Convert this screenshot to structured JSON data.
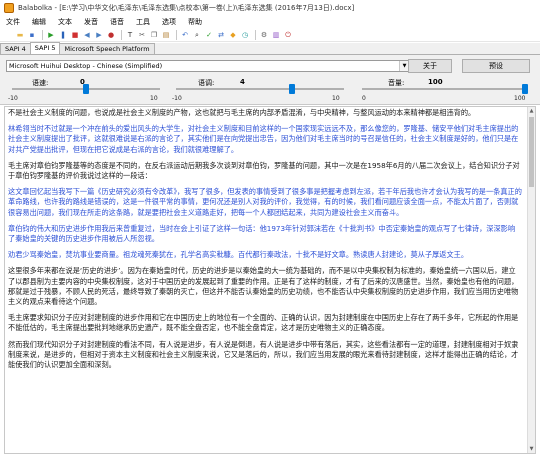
{
  "window": {
    "title": "Balabolka - [E:\\学习\\中华文化\\毛泽东\\毛泽东选集\\点校本\\第一卷(上)\\毛泽东选集 (2016年7月13日).docx]"
  },
  "menu": {
    "items": [
      "文件",
      "编辑",
      "文本",
      "发音",
      "语音",
      "工具",
      "选项",
      "帮助"
    ]
  },
  "toolbar": {
    "buttons": [
      {
        "icon": "new-document-icon",
        "glyph": "▫",
        "color": "#ffffff"
      },
      {
        "icon": "open-folder-icon",
        "glyph": "▬",
        "color": "#e8b84a"
      },
      {
        "icon": "save-icon",
        "glyph": "▪",
        "color": "#3b6ec9"
      },
      {
        "icon": "play-icon",
        "glyph": "▶",
        "color": "#2a9d2a"
      },
      {
        "icon": "pause-icon",
        "glyph": "❚",
        "color": "#2a62b8"
      },
      {
        "icon": "stop-icon",
        "glyph": "■",
        "color": "#d03030"
      },
      {
        "icon": "previous-icon",
        "glyph": "◀",
        "color": "#4a7fc2"
      },
      {
        "icon": "next-icon",
        "glyph": "▶",
        "color": "#4a7fc2"
      },
      {
        "icon": "record-icon",
        "glyph": "●",
        "color": "#c03030"
      },
      {
        "icon": "text-icon",
        "glyph": "T",
        "color": "#333333"
      },
      {
        "icon": "cut-icon",
        "glyph": "✂",
        "color": "#555555"
      },
      {
        "icon": "copy-icon",
        "glyph": "❐",
        "color": "#555555"
      },
      {
        "icon": "paste-icon",
        "glyph": "▤",
        "color": "#b07a2a"
      },
      {
        "icon": "undo-icon",
        "glyph": "↶",
        "color": "#3b6ec9"
      },
      {
        "icon": "find-icon",
        "glyph": "⌕",
        "color": "#333333"
      },
      {
        "icon": "spellcheck-icon",
        "glyph": "✓",
        "color": "#2a9d2a"
      },
      {
        "icon": "replace-icon",
        "glyph": "⇄",
        "color": "#3b6ec9"
      },
      {
        "icon": "bookmark-icon",
        "glyph": "◆",
        "color": "#e8a020"
      },
      {
        "icon": "clock-icon",
        "glyph": "◷",
        "color": "#2a9d9d"
      },
      {
        "icon": "settings-icon",
        "glyph": "⚙",
        "color": "#606060"
      },
      {
        "icon": "dictionary-icon",
        "glyph": "▥",
        "color": "#8a4bc2"
      },
      {
        "icon": "exit-icon",
        "glyph": "⏻",
        "color": "#c03030"
      }
    ]
  },
  "tabs": [
    {
      "label": "SAPI 4",
      "active": false
    },
    {
      "label": "SAPI 5",
      "active": true
    },
    {
      "label": "Microsoft Speech Platform",
      "active": false
    }
  ],
  "voice": {
    "selected": "Microsoft Huihui Desktop - Chinese (Simplified)",
    "apply_label": "关于",
    "preset_label": "预设"
  },
  "sliders": {
    "rate": {
      "label": "语速:",
      "value": "0",
      "min_label": "-10",
      "max_label": "10",
      "position": 0.5
    },
    "pitch": {
      "label": "语调:",
      "value": "4",
      "min_label": "-10",
      "max_label": "10",
      "position": 0.7
    },
    "volume": {
      "label": "音量:",
      "value": "100",
      "min_label": "0",
      "max_label": "100",
      "position": 1.0
    }
  },
  "editor": {
    "paragraphs": [
      {
        "blue": false,
        "text": "不是社会主义制度的问题，也说成是社会主义制度的产物，这也就把与毛主席的内部矛盾混淆，与中央精神，与整风运动的本来精神都是相违背的。"
      },
      {
        "blue": true,
        "text": "林希翎当时不过就是一个冲在前头的爱出风头的大学生，对社会主义制度和目前这样的一个国家现实远远不及，那么像您的，罗隆基、储安平他们对毛主席提出的社会主义制度提出了批评，这就很难说是右派的言论了，其实他们是在向党提出忠告，因为他们对毛主席当时的号召是信任的，社会主义制度是好的，他们只是在对共产党提出批评，但现在把它说成是右派的言论，我们就很难理解了。"
      },
      {
        "blue": false,
        "text": "毛主席对章伯钧罗隆基等的态度是不同的，在反右派运动后期我多次谈到对章伯钧，罗隆基的问题，其中一次是在1958年6月的八届二次会议上，结合知识分子对于章伯钧罗隆基的评价我说过这样的一段话："
      },
      {
        "blue": true,
        "text": "这文章回忆起当我写下一篇《历史研究必须有令改革》，我写了很多，但发表的事情受到了很多事是把握考虑到左派，若干年后我也许才会认为我写的是一条真正的革命路线，也许我的路线是错误的，这是一件很平常的事情，更何况还是别人对我的评价，我觉得，有的时候，我们看问题应该全面一点，不能太片面了，否则就很容易出问题，我们现在所走的这条路，就是要把社会主义道路走好，把每一个人都团结起来，共同为建设社会主义而奋斗。"
      },
      {
        "blue": true,
        "text": "章伯钧的伟大和历史进步作用我后来曾重复过，当时在会上引证了这样一句话：他1973年针对郭沫若在《十批判书》中否定秦始皇的观点写了七律诗，深深影响了秦始皇的关键的历史进步作用被后人所忽视。"
      },
      {
        "blue": true,
        "text": "劝君少骂秦始皇，焚坑事业要商量。祖龙魂死秦犹在，孔学名高实秕糠。百代都行秦政法，十批不是好文章。熟读唐人封建论，莫从子厚返文王。"
      },
      {
        "blue": false,
        "text": "这里很多年来都在说是‘历史的进步’。因为在秦始皇时代，历史的进步是以秦始皇的大一统为基础的，而不是以中央集权制为标准的，秦始皇统一六国以后，建立了以郡县制为主要内容的中央集权制度，这对于中国历史的发展起到了重要的作用。正是有了这样的制度，才有了后来的汉唐盛世。当然，秦始皇也有他的问题，那就是过于残暴，不顾人民的死活，最终导致了秦朝的灭亡，但这并不能否认秦始皇的历史功绩，也不能否认中央集权制度的历史进步作用，我们应当用历史唯物主义的观点来看待这个问题。"
      },
      {
        "blue": false,
        "text": "毛主席要求知识分子应对封建制度的进步作用和它在中国历史上的地位有一个全面的、正确的认识，因为封建制度在中国历史上存在了两千多年，它所起的作用是不能低估的，毛主席提出要批判地继承历史遗产，既不能全盘否定，也不能全盘肯定，这才是历史唯物主义的正确态度。"
      },
      {
        "blue": false,
        "text": "然而我们现代知识分子对封建制度的看法不同，有人说是进步，有人说是倒退，有人说是进步中带有落后，其实，这些看法都有一定的道理，封建制度相对于奴隶制度来说，是进步的，但相对于资本主义制度和社会主义制度来说，它又是落后的，所以，我们应当用发展的眼光来看待封建制度，这样才能得出正确的结论，才能使我们的认识更加全面和深刻。"
      }
    ]
  }
}
